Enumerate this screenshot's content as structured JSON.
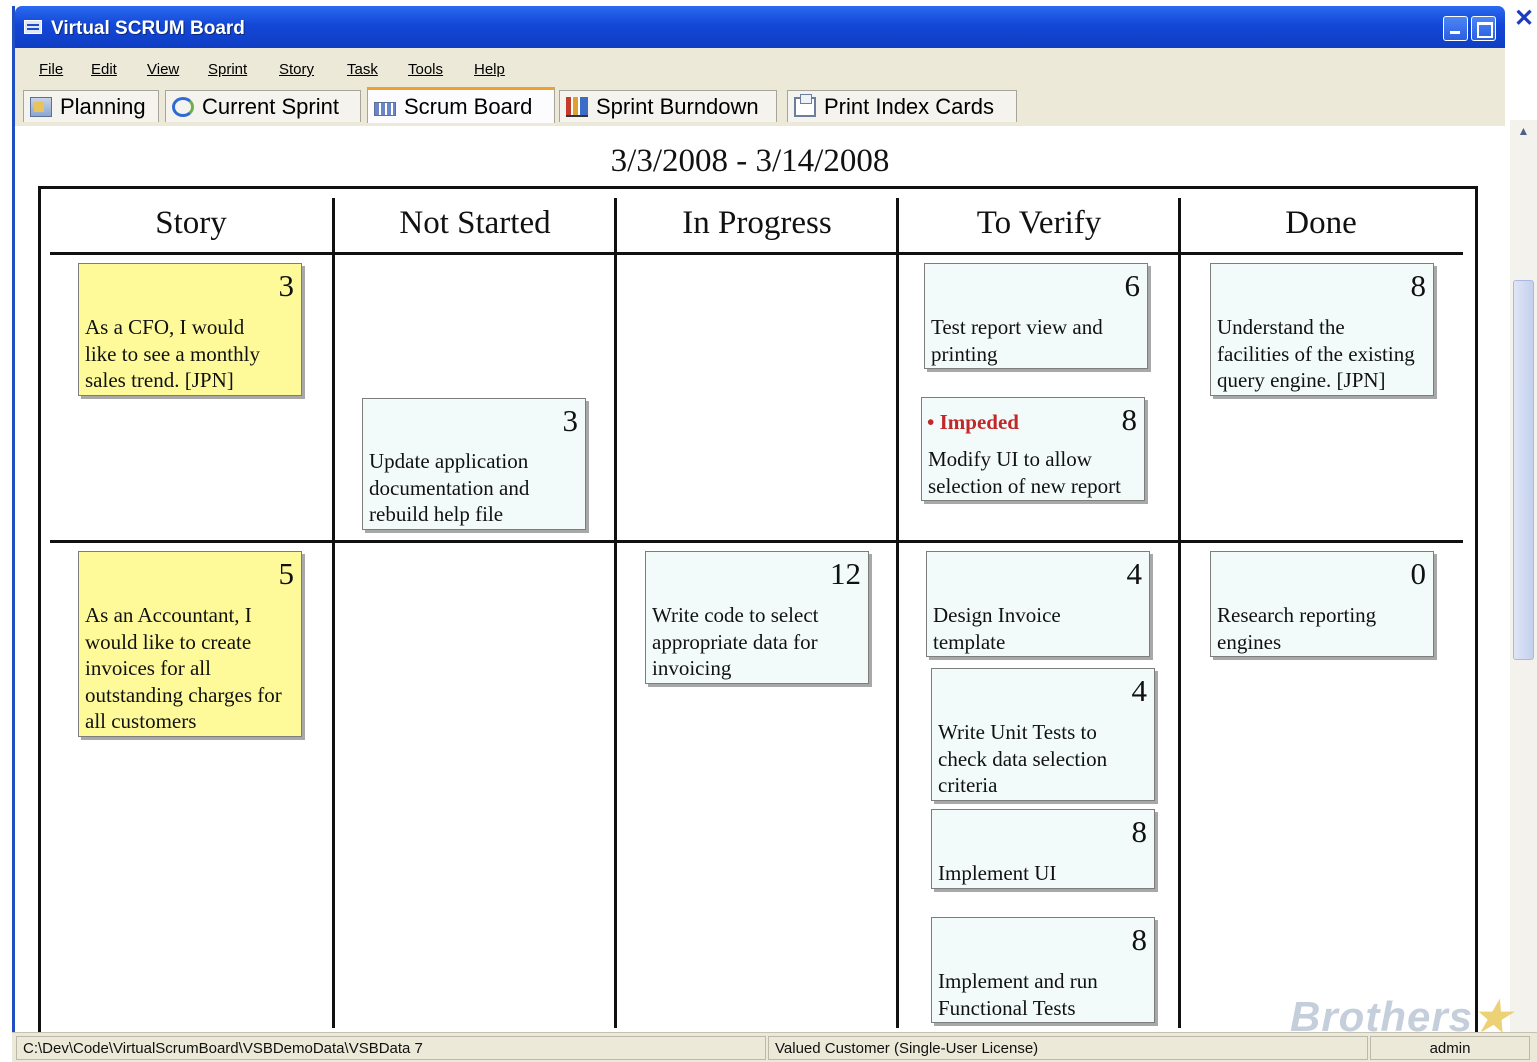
{
  "window": {
    "title": "Virtual SCRUM Board"
  },
  "menu": {
    "items": [
      "File",
      "Edit",
      "View",
      "Sprint",
      "Story",
      "Task",
      "Tools",
      "Help"
    ]
  },
  "tabs": [
    {
      "label": "Planning",
      "icon": "planning-icon"
    },
    {
      "label": "Current Sprint",
      "icon": "current-sprint-icon"
    },
    {
      "label": "Scrum Board",
      "icon": "scrum-board-icon",
      "active": true
    },
    {
      "label": "Sprint Burndown",
      "icon": "burndown-chart-icon"
    },
    {
      "label": "Print Index Cards",
      "icon": "print-cards-icon"
    }
  ],
  "board": {
    "date_range": "3/3/2008 - 3/14/2008",
    "columns": [
      "Story",
      "Not Started",
      "In Progress",
      "To Verify",
      "Done"
    ],
    "rows": [
      {
        "story": {
          "points": "3",
          "text": [
            "As a CFO, I would",
            "like to see a monthly",
            "sales trend. [JPN]"
          ]
        },
        "tasks": [
          {
            "column": "Not Started",
            "points": "3",
            "text": [
              "Update application",
              "documentation and",
              "rebuild help file"
            ]
          },
          {
            "column": "To Verify",
            "points": "6",
            "text": [
              "Test report view and",
              "printing"
            ]
          },
          {
            "column": "To Verify",
            "points": "8",
            "impeded": "• Impeded",
            "text": [
              "Modify UI to allow",
              "selection of new report"
            ]
          },
          {
            "column": "Done",
            "points": "8",
            "text": [
              "Understand the",
              "facilities of the existing",
              "query engine. [JPN]"
            ]
          }
        ]
      },
      {
        "story": {
          "points": "5",
          "text": [
            "As an Accountant, I",
            "would like to create",
            "invoices for all",
            "outstanding charges for",
            "all customers"
          ]
        },
        "tasks": [
          {
            "column": "In Progress",
            "points": "12",
            "text": [
              "Write code to select",
              "appropriate data for",
              "invoicing"
            ]
          },
          {
            "column": "To Verify",
            "points": "4",
            "text": [
              "Design Invoice",
              "template"
            ]
          },
          {
            "column": "To Verify",
            "points": "4",
            "text": [
              "Write Unit Tests to",
              "check data selection",
              "criteria"
            ]
          },
          {
            "column": "To Verify",
            "points": "8",
            "text": [
              "Implement UI"
            ]
          },
          {
            "column": "To Verify",
            "points": "8",
            "text": [
              "Implement and run",
              "Functional Tests"
            ]
          },
          {
            "column": "Done",
            "points": "0",
            "text": [
              "Research reporting",
              "engines"
            ]
          }
        ]
      }
    ]
  },
  "status": {
    "path": "C:\\Dev\\Code\\VirtualScrumBoard\\VSBDemoData\\VSBData 7",
    "license": "Valued Customer  (Single-User License)",
    "user": "admin"
  },
  "watermark": {
    "text": "Brothers"
  },
  "colors": {
    "story_card": "#fefa9a",
    "task_card": "#f2fbfa",
    "titlebar": "#1347d6",
    "impeded": "#c0282a"
  }
}
